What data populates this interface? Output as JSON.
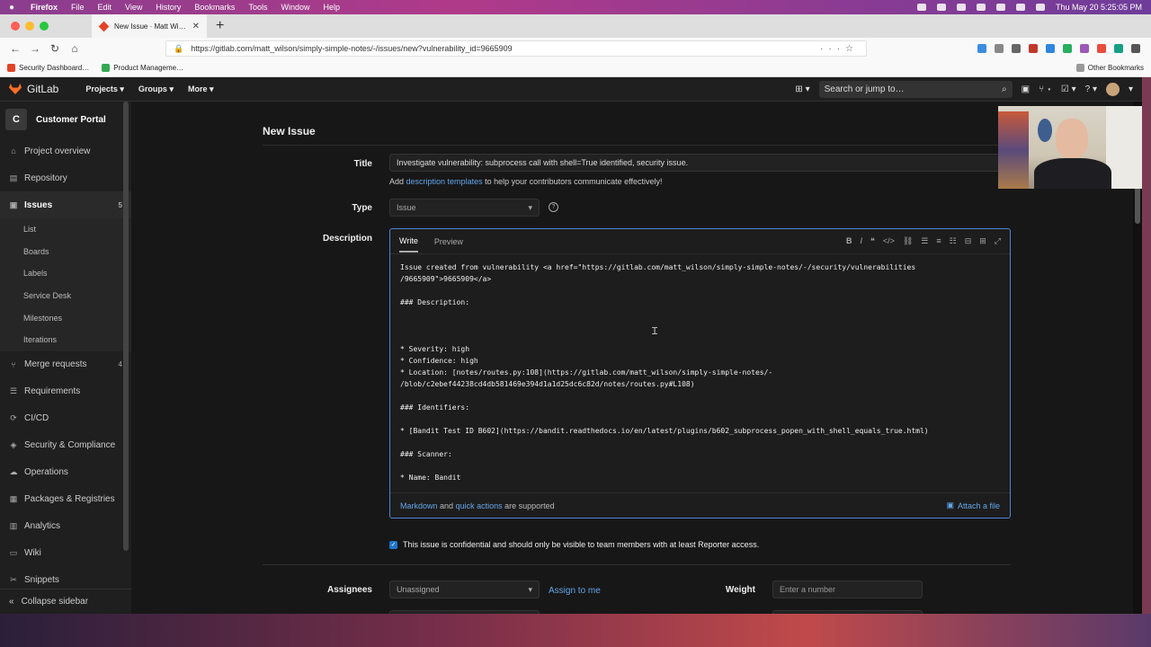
{
  "menubar": {
    "app": "Firefox",
    "items": [
      "File",
      "Edit",
      "View",
      "History",
      "Bookmarks",
      "Tools",
      "Window",
      "Help"
    ],
    "clock": "Thu May 20  5:25:05 PM"
  },
  "browser": {
    "tab_title": "New Issue · Matt Wilson / Cust…",
    "url": "https://gitlab.com/matt_wilson/simply-simple-notes/-/issues/new?vulnerability_id=9665909",
    "bookmarks": [
      "Security Dashboard…",
      "Product Manageme…"
    ],
    "other_bookmarks": "Other Bookmarks"
  },
  "gitlab_header": {
    "brand": "GitLab",
    "nav": [
      "Projects",
      "Groups",
      "More"
    ],
    "search_placeholder": "Search or jump to…"
  },
  "sidebar": {
    "project_initial": "C",
    "project_name": "Customer Portal",
    "items": [
      {
        "label": "Project overview",
        "icon": "home-icon"
      },
      {
        "label": "Repository",
        "icon": "doc-icon"
      },
      {
        "label": "Issues",
        "icon": "issues-icon",
        "count": "5",
        "active": true
      },
      {
        "label": "Merge requests",
        "icon": "merge-icon",
        "count": "4"
      },
      {
        "label": "Requirements",
        "icon": "requirements-icon"
      },
      {
        "label": "CI/CD",
        "icon": "rocket-icon"
      },
      {
        "label": "Security & Compliance",
        "icon": "shield-icon"
      },
      {
        "label": "Operations",
        "icon": "cloud-icon"
      },
      {
        "label": "Packages & Registries",
        "icon": "package-icon"
      },
      {
        "label": "Analytics",
        "icon": "chart-icon"
      },
      {
        "label": "Wiki",
        "icon": "book-icon"
      },
      {
        "label": "Snippets",
        "icon": "snippet-icon"
      }
    ],
    "issues_sub": [
      "List",
      "Boards",
      "Labels",
      "Service Desk",
      "Milestones",
      "Iterations"
    ],
    "collapse_label": "Collapse sidebar"
  },
  "form": {
    "page_title": "New Issue",
    "title_label": "Title",
    "title_value": "Investigate vulnerability: subprocess call with shell=True identified, security issue.",
    "templates_pre": "Add",
    "templates_link": "description templates",
    "templates_post": "to help your contributors communicate effectively!",
    "type_label": "Type",
    "type_value": "Issue",
    "description_label": "Description",
    "tab_write": "Write",
    "tab_preview": "Preview",
    "description_text": "Issue created from vulnerability <a href=\"https://gitlab.com/matt_wilson/simply-simple-notes/-/security/vulnerabilities\n/9665909\">9665909</a>\n\n### Description:\n\n\n\n* Severity: high\n* Confidence: high\n* Location: [notes/routes.py:108](https://gitlab.com/matt_wilson/simply-simple-notes/-\n/blob/c2ebef44238cd4db581469e394d1a1d25dc6c82d/notes/routes.py#L108)\n\n### Identifiers:\n\n* [Bandit Test ID B602](https://bandit.readthedocs.io/en/latest/plugins/b602_subprocess_popen_with_shell_equals_true.html)\n\n### Scanner:\n\n* Name: Bandit",
    "footer_markdown": "Markdown",
    "footer_and": "and",
    "footer_quick": "quick actions",
    "footer_supported": "are supported",
    "attach": "Attach a file",
    "confidential": "This issue is confidential and should only be visible to team members with at least Reporter access.",
    "assignees_label": "Assignees",
    "assignees_value": "Unassigned",
    "assign_me": "Assign to me",
    "weight_label": "Weight",
    "weight_placeholder": "Enter a number"
  }
}
